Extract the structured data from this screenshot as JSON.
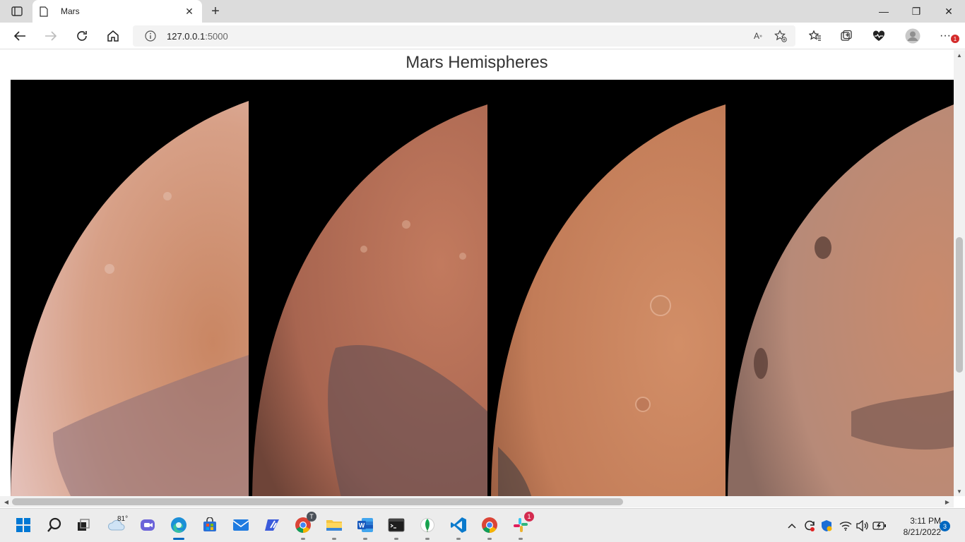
{
  "browser": {
    "tab_title": "Mars",
    "url_host": "127.0.0.1",
    "url_port": ":5000",
    "notification_count": "1"
  },
  "page": {
    "title": "Mars Hemispheres",
    "hemispheres": [
      {
        "icon": "mars-hemisphere-image"
      },
      {
        "icon": "mars-hemisphere-image"
      },
      {
        "icon": "mars-hemisphere-image"
      },
      {
        "icon": "mars-hemisphere-image"
      }
    ]
  },
  "taskbar": {
    "weather_temp": "81°",
    "chrome_profile_letter": "T",
    "slack_badge": "1",
    "time": "3:11 PM",
    "date": "8/21/2022",
    "notification_count": "3",
    "apps": [
      "start-icon",
      "search-icon",
      "task-view-icon",
      "weather-icon",
      "teams-chat-icon",
      "edge-icon",
      "store-icon",
      "mail-icon",
      "power-automate-icon",
      "chrome-icon",
      "file-explorer-icon",
      "word-icon",
      "terminal-icon",
      "mongodb-icon",
      "vscode-icon",
      "chrome-icon",
      "slack-icon"
    ]
  },
  "colors": {
    "accent": "#0067c0",
    "mars_light": "#d9936e",
    "mars_dark": "#8a5a4a",
    "badge_red": "#d42b2b"
  }
}
